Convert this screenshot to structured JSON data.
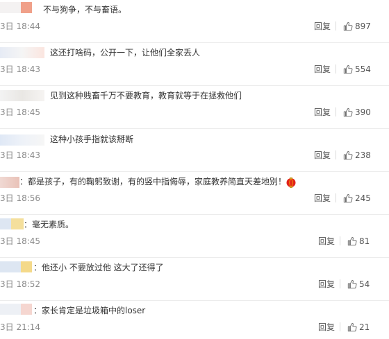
{
  "reply_label": "回复",
  "comments": [
    {
      "text": "不与狗争，不与畜语。",
      "time": "3日 18:44",
      "likes": "897"
    },
    {
      "text": "这还打啥码，公开一下，让他们全家丢人",
      "time": "3日 18:43",
      "likes": "554"
    },
    {
      "text": "见到这种贱畜千万不要教育，教育就等于在拯救他们",
      "time": "3日 18:45",
      "likes": "390"
    },
    {
      "text": "这种小孩手指就该掰断",
      "time": "3日 18:43",
      "likes": "238"
    },
    {
      "text": "：都是孩子，有的鞠躬致谢，有的竖中指侮辱，家庭教养简直天差地别！",
      "time": "3日 18:56",
      "likes": "245"
    },
    {
      "text": "：毫无素质。",
      "time": "3日 18:45",
      "likes": "81"
    },
    {
      "text": "：他还小 不要放过他 这大了还得了",
      "time": "3日 18:52",
      "likes": "54"
    },
    {
      "text": "：家长肯定是垃圾箱中的loser",
      "time": "3日 21:14",
      "likes": "21"
    }
  ],
  "colors": {
    "text": "#333333",
    "time": "#8a8a8a",
    "action": "#555555",
    "divider": "#ececec",
    "emoji": "#e2231a"
  }
}
